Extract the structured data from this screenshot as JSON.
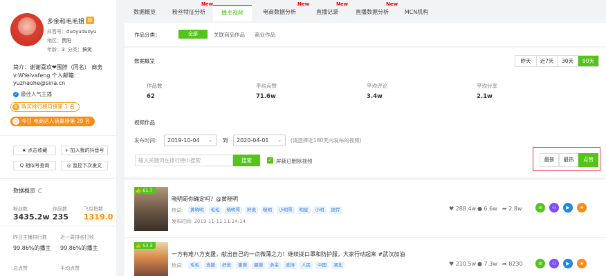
{
  "account": {
    "name": "多余和毛毛姐",
    "badge": "▤",
    "id_label": "抖音号：",
    "id_value": "duoyuduoyu",
    "region_label": "地区：",
    "region_value": "贵阳",
    "age_label": "年龄：",
    "age_value": "3",
    "category_label": "分类：",
    "category_value": "搞笑",
    "bio": "简介：谢谢喜欢❤围脖（同名）  商务v:WYelvafeng 个人邮箱: yuzhaohe@sina.cn",
    "tag": "最佳人气主播",
    "rank1": "购买排行榜月榜第 1 名",
    "rank2": "今日  电商达人销量榜第 29 名"
  },
  "sidebar_buttons": {
    "collect": "★ 点击收藏",
    "add_rank": "+ 加入我的抖音号",
    "similar": "Q 相似号查询",
    "monitor": "◎ 监控下次发文"
  },
  "overview": {
    "title": "数据概览",
    "fans_label": "粉丝数",
    "fans_value": "3435.2w",
    "works_label": "作品数",
    "works_value": "235",
    "index_label": "飞瓜指数",
    "index_value": "1319.0",
    "prev_rank_label": "昨日主播排行数",
    "prev_rank_value": "99.86%的播主",
    "week_rank_label": "近一周排名打败",
    "week_rank_value": "99.86%的播主",
    "total_label": "总点赞",
    "avg_label": "平均点赞"
  },
  "tabs": [
    {
      "label": "数据概览"
    },
    {
      "label": "粉丝特征分析",
      "new": "New"
    },
    {
      "label": "播主视频"
    },
    {
      "label": "电商数据分析",
      "new": "New"
    },
    {
      "label": "直播记录",
      "new": "New"
    },
    {
      "label": "直播数据分析",
      "new": "New"
    },
    {
      "label": "MCN机构"
    }
  ],
  "filter": {
    "label": "作品分类：",
    "all": "全部",
    "product": "关联商品作品",
    "commercial": "商业作品"
  },
  "stats": {
    "title": "数据概览",
    "ranges": [
      "昨天",
      "近7天",
      "30天",
      "90天"
    ],
    "active_range": "90天",
    "works_label": "作品数",
    "works_value": "62",
    "avg_like_label": "平均点赞",
    "avg_like_value": "71.6w",
    "avg_comment_label": "平均评论",
    "avg_comment_value": "3.4w",
    "avg_share_label": "平均分享",
    "avg_share_value": "2.1w"
  },
  "videos_section": {
    "title": "视频作品",
    "time_label": "发布时间:",
    "start_date": "2019-10-04",
    "to": "到",
    "end_date": "2020-04-01",
    "hint": "(请选择近180天内发布的视频)",
    "search_placeholder": "输入关键词在排行榜中搜索",
    "search_btn": "搜索",
    "hide_deleted": "屏蔽已删除视频",
    "sort": [
      "最新",
      "最热",
      "点赞"
    ],
    "active_sort": "点赞"
  },
  "videos": [
    {
      "likes": "61.7",
      "title": "晓明哥你确定吗？@黄晓明",
      "hot_label": "热词:",
      "tags": [
        "黄晓明",
        "毛毛",
        "晓明哥",
        "好说",
        "晓明",
        "小明哥",
        "明星",
        "小明",
        "据传"
      ],
      "time_label": "发布时间:",
      "time": "2019-11-11 11:24:14",
      "like_count": "288.4w",
      "comment_count": "6.6w",
      "share_count": "2.8w"
    },
    {
      "likes": "53.3",
      "title": "一方有难八方支援，献出自己的一点微薄之力！继续拢口罩和防护服，大家行动起来 #武汉加油",
      "hot_label": "热词:",
      "tags": [
        "毛毛",
        "支援",
        "好说",
        "谢谢",
        "摄谢",
        "多余",
        "支持",
        "人民",
        "中国",
        "湖北"
      ],
      "like_count": "210.5w",
      "comment_count": "7.3w",
      "share_count": "8230"
    }
  ],
  "colors": {
    "accent": "#52c41a",
    "orange": "#fa8c16",
    "red_box": "#e53935"
  }
}
